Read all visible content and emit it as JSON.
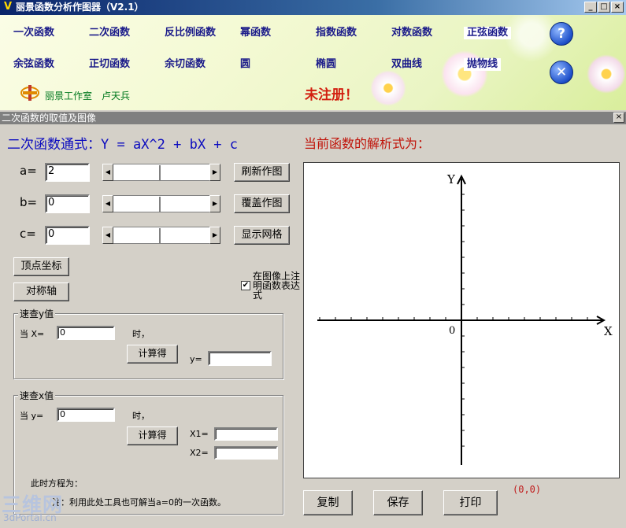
{
  "window": {
    "title": "丽景函数分析作图器（V2.1）"
  },
  "menu": {
    "row1": [
      "一次函数",
      "二次函数",
      "反比例函数",
      "幂函数",
      "指数函数",
      "对数函数",
      "正弦函数"
    ],
    "row2": [
      "余弦函数",
      "正切函数",
      "余切函数",
      "圆",
      "椭圆",
      "双曲线",
      "抛物线"
    ],
    "help_icon": "question-circle-icon",
    "exit_icon": "close-circle-icon",
    "studio": "丽景工作室",
    "author": "卢天兵",
    "unregistered": "未注册！"
  },
  "panel": {
    "title": "二次函数的取值及图像"
  },
  "formula": {
    "label": "二次函数通式：",
    "expression": "Y = aX^2 + bX + c"
  },
  "current_expression_label": "当前函数的解析式为：",
  "params": {
    "a": {
      "label": "a=",
      "value": "2"
    },
    "b": {
      "label": "b=",
      "value": "0"
    },
    "c": {
      "label": "c=",
      "value": "0"
    }
  },
  "buttons": {
    "refresh": "刷新作图",
    "overlay": "覆盖作图",
    "grid": "显示网格",
    "vertex": "顶点坐标",
    "axis": "对称轴",
    "compute": "计算得",
    "copy": "复制",
    "save": "保存",
    "print": "打印"
  },
  "annotate": {
    "label": "在图像上注明函数表达式",
    "checked": true
  },
  "quick_y": {
    "title": "速查y值",
    "when": "当 X=",
    "input": "0",
    "time": "时，",
    "y_label": "y=",
    "y_value": ""
  },
  "quick_x": {
    "title": "速查x值",
    "when": "当 y=",
    "input": "0",
    "time": "时，",
    "x1_label": "X1=",
    "x2_label": "X2=",
    "x1_value": "",
    "x2_value": "",
    "equation_label": "此时方程为：",
    "note": "注：利用此处工具也可解当a=0的一次函数。"
  },
  "graph": {
    "x_axis": "X",
    "y_axis": "Y",
    "origin": "0",
    "coord_readout": "(0,0)"
  },
  "watermark": {
    "main": "三维网",
    "sub": "3dPortal.cn"
  }
}
